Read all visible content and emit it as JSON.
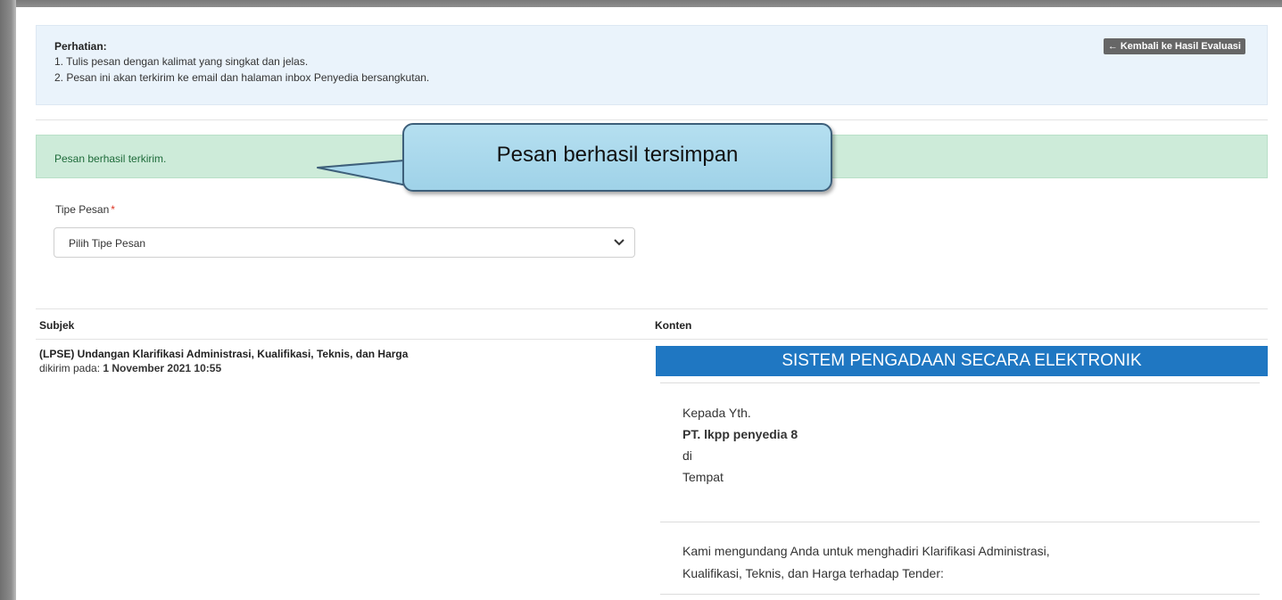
{
  "notice": {
    "title": "Perhatian:",
    "line1": "1. Tulis pesan dengan kalimat yang singkat dan jelas.",
    "line2": "2. Pesan ini akan terkirim ke email dan halaman inbox Penyedia bersangkutan.",
    "back_button": "Kembali ke Hasil Evaluasi",
    "back_icon": "arrow-left"
  },
  "success_alert": "Pesan berhasil terkirim.",
  "callout": "Pesan berhasil tersimpan",
  "form": {
    "tipe_label": "Tipe Pesan",
    "required_mark": "*",
    "tipe_select_value": "Pilih Tipe Pesan"
  },
  "table": {
    "col_subject": "Subjek",
    "col_content": "Konten",
    "row": {
      "subject": "(LPSE) Undangan Klarifikasi Administrasi, Kualifikasi, Teknis, dan Harga",
      "sent_prefix": "dikirim pada:",
      "sent_date": "1 November 2021 10:55"
    }
  },
  "email": {
    "banner": "SISTEM PENGADAAN SECARA ELEKTRONIK",
    "greeting": "Kepada Yth.",
    "recipient": "PT. lkpp penyedia 8",
    "di": "di",
    "place": "Tempat",
    "body_line1": "Kami mengundang Anda untuk menghadiri Klarifikasi Administrasi,",
    "body_line2": "Kualifikasi, Teknis, dan Harga terhadap Tender:"
  },
  "colors": {
    "notice_bg": "#eaf3fb",
    "success_bg": "#cdebd9",
    "banner_bg": "#1f77c2",
    "callout_bg": "#a8d8ec",
    "required": "#dd3322"
  }
}
